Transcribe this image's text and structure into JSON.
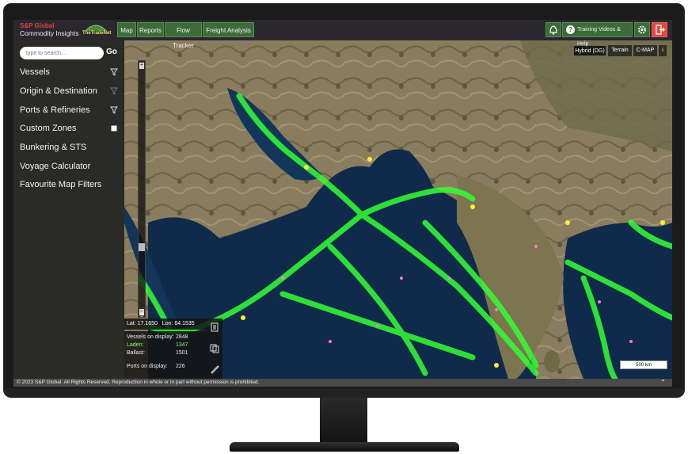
{
  "header": {
    "brand_line1": "S&P Global",
    "brand_line2": "Commodity Insights",
    "partner_logo": "TheTradeNet",
    "nav": [
      "Map",
      "Reports",
      "Flow Tracker",
      "Freight Analysis"
    ],
    "help_label": "Training Videos & Help",
    "icons": [
      "bell-icon",
      "help-icon",
      "gear-icon",
      "logout-icon"
    ]
  },
  "sidebar": {
    "search_placeholder": "type to search...",
    "go_label": "Go",
    "items": [
      {
        "label": "Vessels",
        "icon": "filter-icon"
      },
      {
        "label": "Origin & Destination",
        "icon": "filter-icon"
      },
      {
        "label": "Ports & Refineries",
        "icon": "filter-icon"
      },
      {
        "label": "Custom Zones",
        "icon": "checkbox-icon"
      },
      {
        "label": "Bunkering & STS",
        "icon": ""
      },
      {
        "label": "Voyage Calculator",
        "icon": ""
      },
      {
        "label": "Favourite Map Filters",
        "icon": ""
      }
    ]
  },
  "map": {
    "types": [
      "Hybrid (DG)",
      "Terrain",
      "C-MAP",
      "i"
    ],
    "zoom_plus": "+",
    "zoom_minus": "−",
    "zoom_level": "5",
    "lat_label": "Lat:",
    "lat_value": "17.1650",
    "lon_label": "Lon:",
    "lon_value": "64.1535",
    "scale": "500 km"
  },
  "stats": {
    "vessels_label": "Vessels on display:",
    "vessels_value": "2848",
    "laden_label": "Laden:",
    "laden_value": "1347",
    "ballast_label": "Ballast:",
    "ballast_value": "1501",
    "ports_label": "Ports on display:",
    "ports_value": "226"
  },
  "footer": {
    "copyright": "© 2023 S&P Global. All Rights Reserved. Reproduction in whole or in part without permission is prohibited."
  },
  "colors": {
    "nav_green": "#3c6b3a",
    "brand_red": "#e0443b",
    "vessel_green": "#33ff33",
    "ocean": "#0f2a4a"
  }
}
